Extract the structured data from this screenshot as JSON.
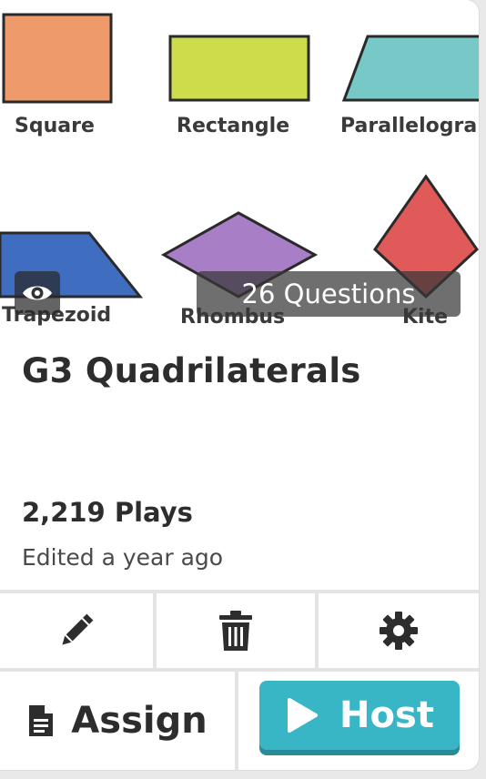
{
  "thumbnail": {
    "shapes": [
      {
        "label": "Square",
        "color": "#ef9a6a"
      },
      {
        "label": "Rectangle",
        "color": "#cddc4a"
      },
      {
        "label": "Parallelogra",
        "color": "#76c9c6"
      },
      {
        "label": "Trapezoid",
        "color": "#3f6ec0"
      },
      {
        "label": "Rhombus",
        "color": "#a87fc7"
      },
      {
        "label": "Kite",
        "color": "#e05a5a"
      }
    ],
    "questions_badge": "26 Questions"
  },
  "quiz": {
    "title": "G3 Quadrilaterals",
    "plays": "2,219 Plays",
    "edited": "Edited a year ago"
  },
  "actions": {
    "icons": [
      "pencil-icon",
      "trash-icon",
      "gear-icon"
    ],
    "assign_label": "Assign",
    "host_label": "Host"
  },
  "colors": {
    "host_button": "#38b6c5",
    "host_button_shadow": "#2a8b98"
  }
}
